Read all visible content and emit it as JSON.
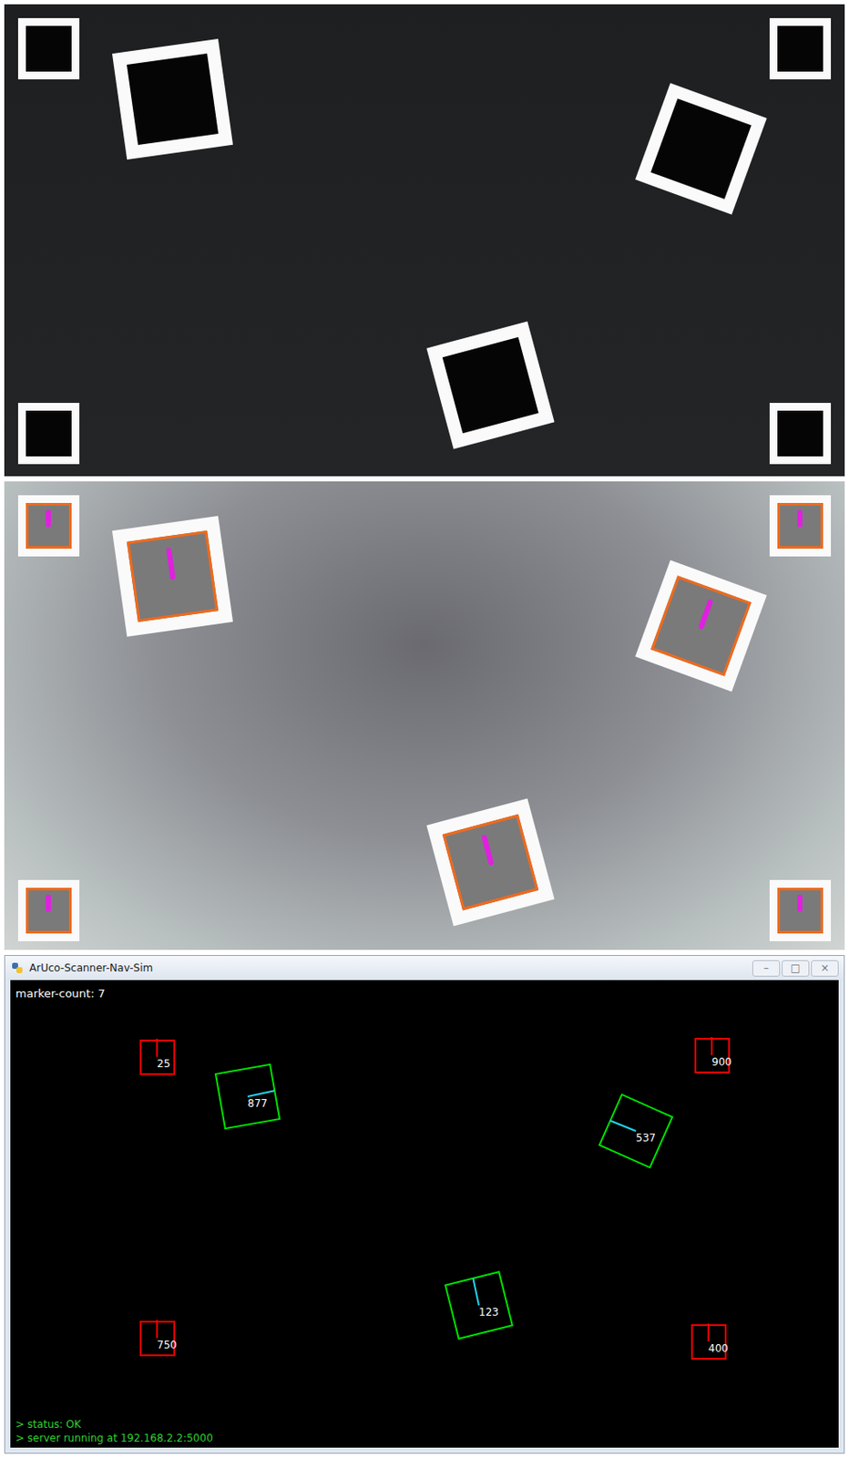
{
  "window": {
    "title": "ArUco-Scanner-Nav-Sim",
    "controls": [
      "–",
      "□",
      "×"
    ]
  },
  "canvas": {
    "marker_count": "marker-count: 7"
  },
  "markers": [
    {
      "id": "25",
      "kind": "anchor",
      "color": "#ff0000"
    },
    {
      "id": "900",
      "kind": "anchor",
      "color": "#ff0000"
    },
    {
      "id": "750",
      "kind": "anchor",
      "color": "#ff0000"
    },
    {
      "id": "400",
      "kind": "anchor",
      "color": "#ff0000"
    },
    {
      "id": "877",
      "kind": "robot",
      "color": "#00e000"
    },
    {
      "id": "537",
      "kind": "robot",
      "color": "#00e000"
    },
    {
      "id": "123",
      "kind": "robot",
      "color": "#00e000"
    }
  ],
  "console": [
    "> status: OK",
    "> server running at 192.168.2.2:5000"
  ]
}
